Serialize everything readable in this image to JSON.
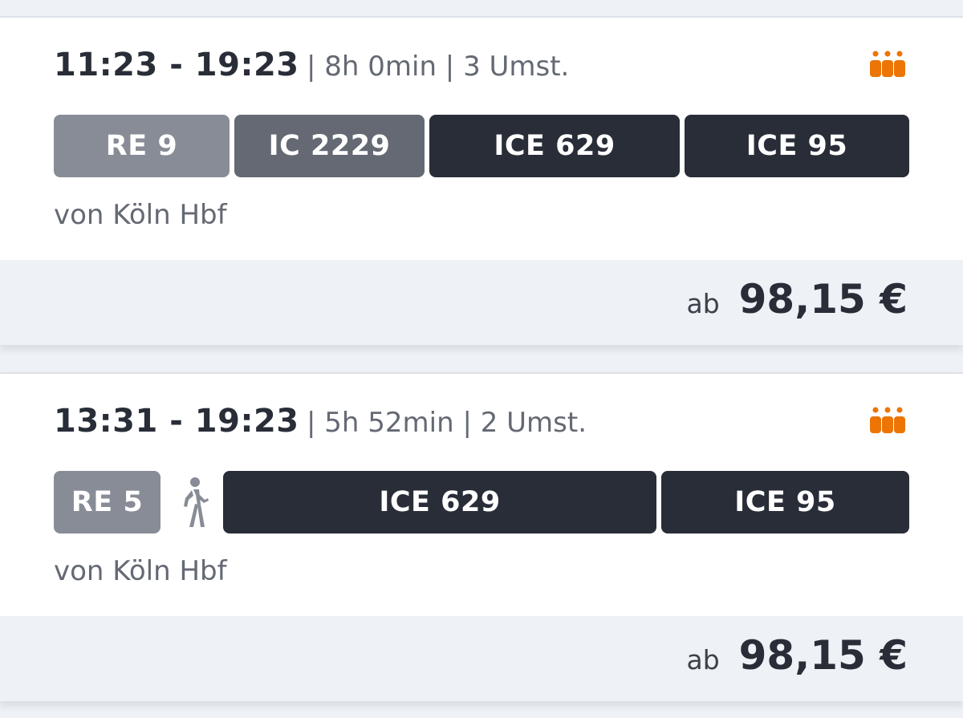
{
  "connections": [
    {
      "time_range": "11:23 - 19:23",
      "details": "| 8h 0min | 3 Umst.",
      "occupancy_icon": "occupancy-low-icon",
      "trains": [
        {
          "label": "RE 9",
          "kind": "re"
        },
        {
          "label": "IC 2229",
          "kind": "ic"
        },
        {
          "label": "ICE 629",
          "kind": "ice"
        },
        {
          "label": "ICE 95",
          "kind": "ice"
        }
      ],
      "origin": "von Köln Hbf",
      "price_prefix": "ab",
      "price": "98,15 €"
    },
    {
      "time_range": "13:31 - 19:23",
      "details": "| 5h 52min | 2 Umst.",
      "occupancy_icon": "occupancy-low-icon",
      "trains": [
        {
          "label": "RE 5",
          "kind": "re"
        },
        {
          "label": "walk",
          "kind": "walk",
          "icon": "walking-person-icon"
        },
        {
          "label": "ICE 629",
          "kind": "ice"
        },
        {
          "label": "ICE 95",
          "kind": "ice"
        }
      ],
      "origin": "von Köln Hbf",
      "price_prefix": "ab",
      "price": "98,15 €"
    }
  ],
  "colors": {
    "accent_occupancy": "#ec7505",
    "regional_train": "#878c96",
    "intercity_train": "#646973",
    "ice_train": "#282d37",
    "background": "#eef1f5",
    "text_primary": "#282d37",
    "text_secondary": "#646973"
  }
}
